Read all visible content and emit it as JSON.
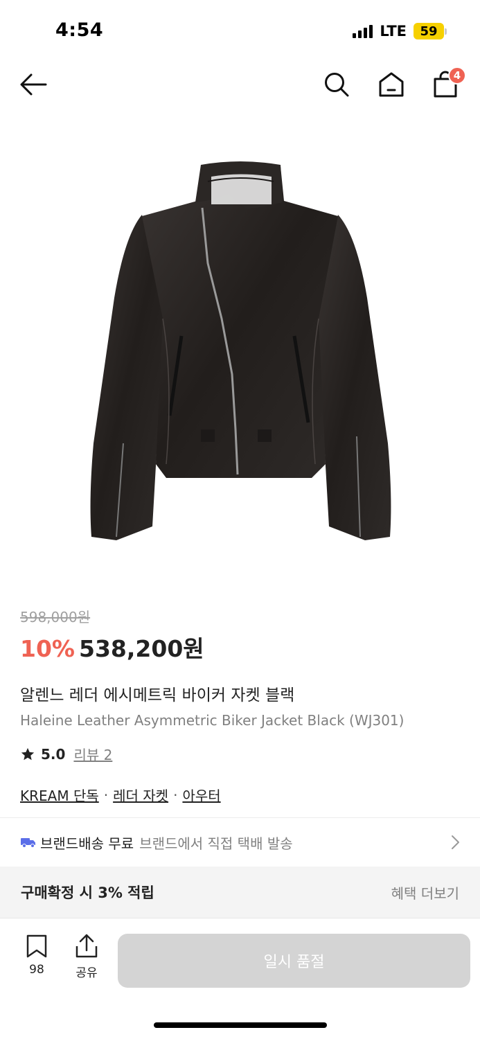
{
  "status_bar": {
    "time": "4:54",
    "network": "LTE",
    "battery": "59",
    "battery_color": "#f6d000"
  },
  "nav": {
    "back_icon": "arrow-left-icon",
    "search_icon": "search-icon",
    "home_icon": "home-icon",
    "cart_icon": "shopping-bag-icon",
    "cart_badge": "4",
    "badge_color": "#ef6253"
  },
  "product": {
    "image_alt": "black leather biker jacket",
    "original_price": "598,000원",
    "discount": "10%",
    "price": "538,200원",
    "name_ko": "알렌느 레더 에시메트릭 바이커 자켓 블랙",
    "name_en": "Haleine Leather Asymmetric Biker Jacket Black (WJ301)",
    "rating": "5.0",
    "review_label": "리뷰 2",
    "tags": [
      "KREAM 단독",
      "레더 자켓",
      "아우터"
    ],
    "tag_separator": "·"
  },
  "shipping": {
    "icon": "truck-icon",
    "title": "브랜드배송 무료",
    "description": "브랜드에서 직접 택배 발송",
    "icon_color": "#5b6ee8"
  },
  "benefit": {
    "title": "구매확정 시 3% 적립",
    "more": "혜택 더보기"
  },
  "bottom_bar": {
    "bookmark_count": "98",
    "share_label": "공유",
    "soldout_label": "일시 품절"
  }
}
